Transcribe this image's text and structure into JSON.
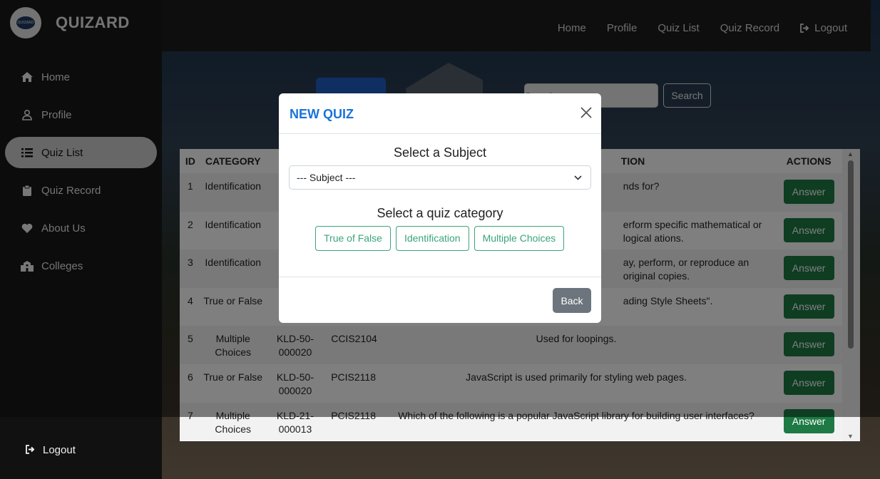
{
  "brand": {
    "name": "QUIZARD",
    "logo_text": "QUIZARD"
  },
  "sidebar": {
    "items": [
      {
        "label": "Home",
        "icon": "home-icon"
      },
      {
        "label": "Profile",
        "icon": "user-icon"
      },
      {
        "label": "Quiz List",
        "icon": "list-icon"
      },
      {
        "label": "Quiz Record",
        "icon": "clipboard-icon"
      },
      {
        "label": "About Us",
        "icon": "heart-icon"
      },
      {
        "label": "Colleges",
        "icon": "building-icon"
      }
    ],
    "active": "Quiz List",
    "logout_label": "Logout"
  },
  "topnav": {
    "items": [
      "Home",
      "Profile",
      "Quiz List",
      "Quiz Record"
    ],
    "logout_label": "Logout"
  },
  "search": {
    "placeholder": "Search",
    "button_label": "Search"
  },
  "table": {
    "headers": [
      "ID",
      "CATEGORY",
      "",
      "",
      "TION",
      "ACTIONS"
    ],
    "rows": [
      {
        "id": "1",
        "category": "Identification",
        "code": "",
        "subject": "",
        "question": "nds for?",
        "action": "Answer"
      },
      {
        "id": "2",
        "category": "Identification",
        "code": "",
        "subject": "",
        "question": "erform specific mathematical or logical ations.",
        "action": "Answer"
      },
      {
        "id": "3",
        "category": "Identification",
        "code": "",
        "subject": "",
        "question": "ay, perform, or reproduce an original copies.",
        "action": "Answer"
      },
      {
        "id": "4",
        "category": "True or False",
        "code": "",
        "subject": "",
        "question": "ading Style Sheets\".",
        "action": "Answer"
      },
      {
        "id": "5",
        "category": "Multiple Choices",
        "code": "KLD-50-000020",
        "subject": "CCIS2104",
        "question": "Used for loopings.",
        "action": "Answer"
      },
      {
        "id": "6",
        "category": "True or False",
        "code": "KLD-50-000020",
        "subject": "PCIS2118",
        "question": "JavaScript is used primarily for styling web pages.",
        "action": "Answer"
      },
      {
        "id": "7",
        "category": "Multiple Choices",
        "code": "KLD-21-000013",
        "subject": "PCIS2118",
        "question": "Which of the following is a popular JavaScript library for building user interfaces?",
        "action": "Answer"
      }
    ]
  },
  "modal": {
    "title": "NEW QUIZ",
    "subject_heading": "Select a Subject",
    "subject_select_value": "--- Subject ---",
    "category_heading": "Select a quiz category",
    "categories": [
      "True of False",
      "Identification",
      "Multiple Choices"
    ],
    "back_label": "Back"
  },
  "colors": {
    "accent_blue": "#1a73d9",
    "answer_green": "#1d7a45",
    "category_outline": "#3aa57b",
    "back_gray": "#6c757d"
  }
}
